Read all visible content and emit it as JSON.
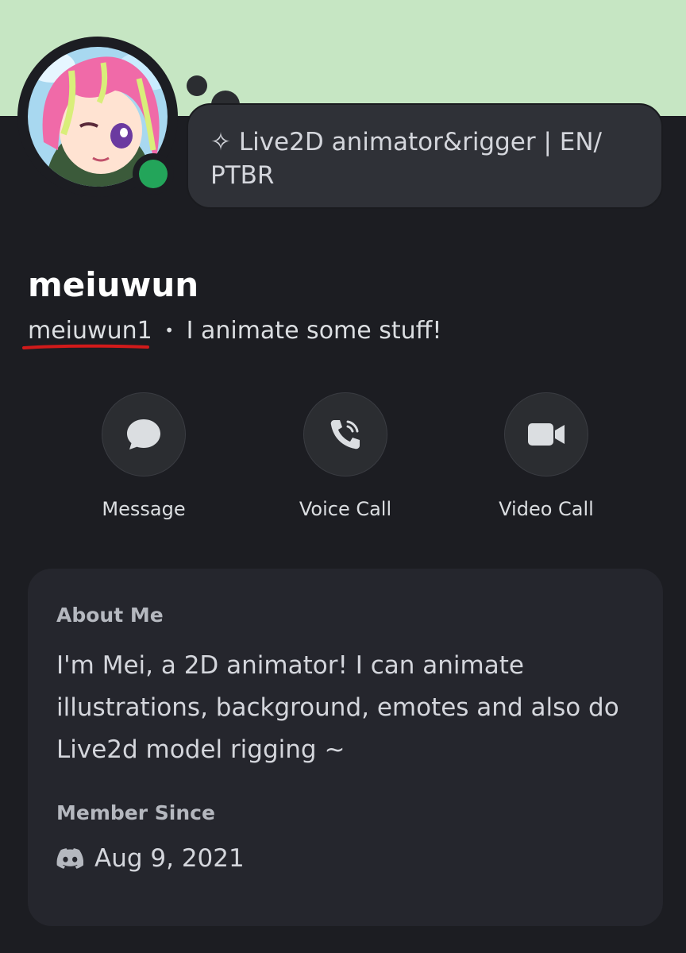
{
  "profile": {
    "display_name": "meiuwun",
    "username": "meiuwun1",
    "separator": "•",
    "pronoun_line": "I animate some stuff!",
    "custom_status": "✧ Live2D animator&rigger | EN/ PTBR",
    "online_status": "online"
  },
  "actions": [
    {
      "label": "Message",
      "icon": "message-bubble-icon"
    },
    {
      "label": "Voice Call",
      "icon": "phone-call-icon"
    },
    {
      "label": "Video Call",
      "icon": "video-camera-icon"
    }
  ],
  "about": {
    "title": "About Me",
    "text": "I'm Mei, a 2D animator! I can animate illustrations, background, emotes and also do Live2d model rigging ~"
  },
  "member_since": {
    "title": "Member Since",
    "date": "Aug 9, 2021",
    "icon": "discord-logo-icon"
  },
  "colors": {
    "banner": "#c6e6c3",
    "background": "#1c1d22",
    "card": "#25262d",
    "online": "#23a55a",
    "annotation_underline": "#d11a1a"
  }
}
